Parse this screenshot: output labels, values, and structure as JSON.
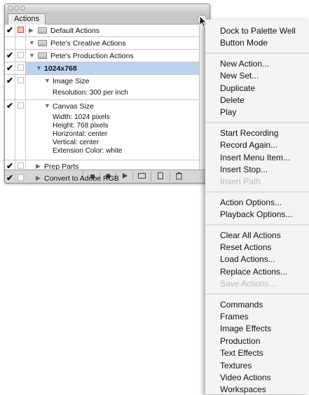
{
  "panel": {
    "tab_label": "Actions",
    "menu_arrow_glyph": "►",
    "rows": [
      {
        "kind": "set",
        "label": "Default Actions",
        "checked": true,
        "dialog": true,
        "expanded": false
      },
      {
        "kind": "set",
        "label": "Pete's Creative Actions",
        "checked": false,
        "dialog": false,
        "expanded": true
      },
      {
        "kind": "set",
        "label": "Pete's Production Actions",
        "checked": true,
        "dialog": false,
        "expanded": true
      },
      {
        "kind": "action",
        "label": "1024x768",
        "checked": true,
        "selected": true,
        "expanded": true
      },
      {
        "kind": "step",
        "label": "Image Size",
        "checked": true,
        "details": [
          "Resolution: 300 per inch"
        ]
      },
      {
        "kind": "step",
        "label": "Canvas Size",
        "checked": true,
        "details": [
          "Width: 1024 pixels",
          "Height: 768 pixels",
          "Horizontal: center",
          "Vertical: center",
          "Extension Color: white"
        ]
      },
      {
        "kind": "action",
        "label": "Prep Parts",
        "checked": true,
        "expanded": false
      },
      {
        "kind": "action",
        "label": "Convert to Adobe RGB",
        "checked": true,
        "expanded": false
      }
    ],
    "check_glyph": "✔",
    "expand_glyph": "▼",
    "collapse_glyph": "▶"
  },
  "menu": {
    "groups": [
      [
        "Dock to Palette Well",
        "Button Mode"
      ],
      [
        "New Action...",
        "New Set...",
        "Duplicate",
        "Delete",
        "Play"
      ],
      [
        "Start Recording",
        "Record Again...",
        "Insert Menu Item...",
        "Insert Stop...",
        "Insert Path"
      ],
      [
        "Action Options...",
        "Playback Options..."
      ],
      [
        "Clear All Actions",
        "Reset Actions",
        "Load Actions...",
        "Replace Actions...",
        "Save Actions..."
      ],
      [
        "Commands",
        "Frames",
        "Image Effects",
        "Production",
        "Text Effects",
        "Textures",
        "Video Actions",
        "Workspaces"
      ]
    ],
    "disabled": [
      "Insert Path",
      "Save Actions..."
    ]
  },
  "colors": {
    "selection": "#bcd3f0",
    "disabled_text": "#b9b9b9"
  }
}
